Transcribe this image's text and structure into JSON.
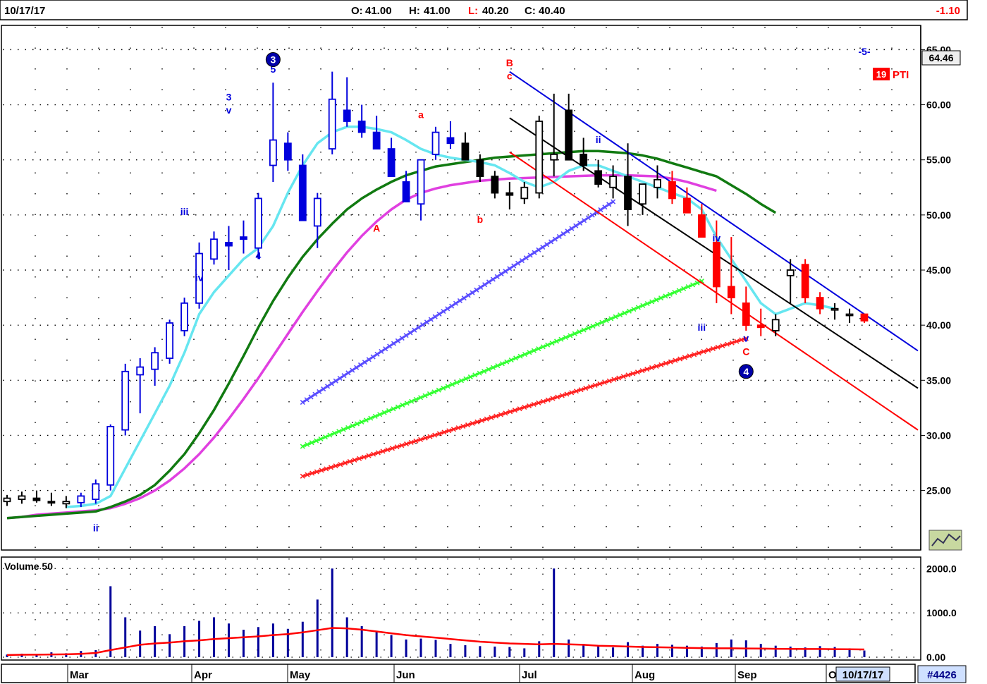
{
  "header": {
    "date": "10/17/17",
    "open_label": "O:",
    "open": "41.00",
    "high_label": "H:",
    "high": "41.00",
    "low_label": "L:",
    "low": "40.20",
    "close_label": "C:",
    "close": "40.40",
    "change": "-1.10"
  },
  "price_panel": {
    "last_price_tag": "64.46",
    "pti_value": "19",
    "pti_label": "PTI",
    "y_ticks": [
      "25.00",
      "30.00",
      "35.00",
      "40.00",
      "45.00",
      "50.00",
      "55.00",
      "60.00",
      "65.00"
    ]
  },
  "volume_panel": {
    "label": "Volume 50",
    "y_ticks": [
      "0.00",
      "1000.0",
      "2000.0"
    ]
  },
  "x_axis": {
    "months": [
      "Mar",
      "Apr",
      "May",
      "Jun",
      "Jul",
      "Aug",
      "Sep",
      "O"
    ],
    "current_date": "10/17/17",
    "chart_number": "#4426"
  },
  "colors": {
    "up_candle": "#0000dd",
    "down_candle": "#000000",
    "red_candle": "#ff0000",
    "ma_short": "#66e6f0",
    "ma_mid": "#117a11",
    "ma_long": "#e040e0",
    "volume_bar": "#00009a",
    "volume_avg": "#ff0000"
  },
  "chart_data": {
    "type": "candlestick",
    "ylim": [
      20,
      67
    ],
    "volume_ylim": [
      0,
      2100
    ],
    "grid": true,
    "dates": [
      "Feb 14",
      "Feb 17",
      "Feb 22",
      "Feb 27",
      "Mar 2",
      "Mar 7",
      "Mar 10",
      "Mar 15",
      "Mar 20",
      "Mar 23",
      "Mar 28",
      "Mar 31",
      "Apr 5",
      "Apr 10",
      "Apr 13",
      "Apr 18",
      "Apr 21",
      "Apr 26",
      "May 1",
      "May 4",
      "May 9",
      "May 12",
      "May 17",
      "May 22",
      "May 25",
      "May 30",
      "Jun 2",
      "Jun 7",
      "Jun 12",
      "Jun 15",
      "Jun 20",
      "Jun 23",
      "Jun 28",
      "Jul 3",
      "Jul 6",
      "Jul 11",
      "Jul 14",
      "Jul 19",
      "Jul 24",
      "Jul 27",
      "Aug 1",
      "Aug 4",
      "Aug 9",
      "Aug 14",
      "Aug 17",
      "Aug 22",
      "Aug 25",
      "Aug 30",
      "Sep 5",
      "Sep 8",
      "Sep 13",
      "Sep 18",
      "Sep 21",
      "Sep 26",
      "Sep 29",
      "Oct 4",
      "Oct 9",
      "Oct 12",
      "Oct 17"
    ],
    "open": [
      24.0,
      24.2,
      24.3,
      24.0,
      23.8,
      23.9,
      24.2,
      25.5,
      30.5,
      35.5,
      36.0,
      37.0,
      39.5,
      42.0,
      46.0,
      47.5,
      48.0,
      47.0,
      54.5,
      56.5,
      54.5,
      49.0,
      56.0,
      59.5,
      58.5,
      57.5,
      56.0,
      53.0,
      51.0,
      55.5,
      57.0,
      56.5,
      55.0,
      53.5,
      52.0,
      51.5,
      52.0,
      55.0,
      59.5,
      55.5,
      54.0,
      52.5,
      53.5,
      51.0,
      52.5,
      53.0,
      51.5,
      50.0,
      47.5,
      43.5,
      42.0,
      40.0,
      39.5,
      44.5,
      45.5,
      42.5,
      41.5,
      41.0,
      41.0
    ],
    "high": [
      24.6,
      24.9,
      25.0,
      24.8,
      24.5,
      24.8,
      26.0,
      31.0,
      36.5,
      37.0,
      38.0,
      40.5,
      42.5,
      47.5,
      48.5,
      49.0,
      49.5,
      52.0,
      62.0,
      57.5,
      55.5,
      52.0,
      63.0,
      62.5,
      60.0,
      59.0,
      57.0,
      54.0,
      52.5,
      58.0,
      58.5,
      57.5,
      55.5,
      54.0,
      53.0,
      53.0,
      59.0,
      61.0,
      61.0,
      57.0,
      55.0,
      54.5,
      56.5,
      52.5,
      54.5,
      54.0,
      52.5,
      51.0,
      49.5,
      48.0,
      43.5,
      41.5,
      41.0,
      46.0,
      46.0,
      43.0,
      42.0,
      41.5,
      41.0
    ],
    "low": [
      23.6,
      23.8,
      23.9,
      23.6,
      23.4,
      23.5,
      23.8,
      25.0,
      30.0,
      32.0,
      34.5,
      36.5,
      39.0,
      41.5,
      45.5,
      45.0,
      46.5,
      46.0,
      53.0,
      54.0,
      51.0,
      47.0,
      55.5,
      58.0,
      57.0,
      56.5,
      54.0,
      51.5,
      49.5,
      55.0,
      56.0,
      55.0,
      53.0,
      51.5,
      50.5,
      51.0,
      51.5,
      53.5,
      55.5,
      54.0,
      52.5,
      51.5,
      49.0,
      50.0,
      51.5,
      51.0,
      50.5,
      49.5,
      42.0,
      41.0,
      39.5,
      39.0,
      39.0,
      42.0,
      42.0,
      41.0,
      40.5,
      40.2,
      40.2
    ],
    "close": [
      24.3,
      24.5,
      24.1,
      23.9,
      24.0,
      24.5,
      25.6,
      30.8,
      35.8,
      36.2,
      37.5,
      40.2,
      42.0,
      46.5,
      47.8,
      47.2,
      47.8,
      51.5,
      56.8,
      55.0,
      49.5,
      51.5,
      60.5,
      58.5,
      57.5,
      56.0,
      53.5,
      51.2,
      55.0,
      57.5,
      56.5,
      55.0,
      53.5,
      52.0,
      51.8,
      52.5,
      58.5,
      55.5,
      55.0,
      54.5,
      52.8,
      53.5,
      50.5,
      52.8,
      53.2,
      51.5,
      50.2,
      48.0,
      43.5,
      42.5,
      40.0,
      39.8,
      40.5,
      45.0,
      42.5,
      41.5,
      41.5,
      41.0,
      40.4
    ],
    "volume": [
      60,
      80,
      50,
      110,
      90,
      140,
      160,
      1600,
      900,
      600,
      700,
      520,
      700,
      820,
      900,
      760,
      620,
      680,
      760,
      640,
      800,
      1300,
      2000,
      900,
      700,
      580,
      500,
      400,
      420,
      390,
      300,
      270,
      250,
      240,
      230,
      200,
      360,
      2000,
      400,
      300,
      260,
      220,
      340,
      260,
      300,
      280,
      260,
      240,
      320,
      400,
      380,
      300,
      260,
      240,
      220,
      250,
      230,
      200,
      150
    ],
    "volume_avg": [
      50,
      55,
      58,
      62,
      66,
      75,
      95,
      160,
      220,
      280,
      310,
      330,
      360,
      380,
      410,
      430,
      450,
      470,
      500,
      520,
      560,
      610,
      660,
      650,
      620,
      580,
      540,
      500,
      470,
      440,
      410,
      380,
      350,
      330,
      310,
      300,
      290,
      300,
      290,
      280,
      260,
      250,
      240,
      230,
      225,
      220,
      210,
      205,
      200,
      200,
      198,
      195,
      190,
      188,
      185,
      185,
      182,
      180,
      175
    ],
    "ma_short": [
      null,
      null,
      null,
      null,
      23.5,
      23.6,
      23.8,
      24.5,
      27,
      29.5,
      32,
      34.5,
      37.5,
      41,
      43,
      44.5,
      46,
      47,
      49,
      52,
      54.5,
      56.5,
      57.5,
      58,
      58,
      57.8,
      57.5,
      56.8,
      56,
      55.5,
      55.2,
      55,
      54.8,
      54.5,
      53.8,
      53,
      52.5,
      53,
      54,
      54.5,
      54.5,
      54,
      53.5,
      53,
      52.5,
      52,
      51.5,
      50.5,
      48,
      46,
      44,
      42,
      41,
      41.5,
      42,
      41.8,
      41.5,
      null,
      null
    ],
    "ma_mid": [
      22.5,
      22.6,
      22.7,
      22.8,
      22.9,
      23,
      23.1,
      23.5,
      24,
      24.6,
      25.5,
      26.8,
      28.3,
      30.2,
      32.3,
      34.7,
      37.2,
      39.8,
      42.2,
      44.3,
      46.2,
      47.8,
      49.2,
      50.5,
      51.5,
      52.3,
      53,
      53.6,
      54,
      54.4,
      54.6,
      54.8,
      55,
      55.2,
      55.3,
      55.4,
      55.5,
      55.6,
      55.7,
      55.8,
      55.8,
      55.7,
      55.6,
      55.4,
      55.1,
      54.7,
      54.3,
      53.9,
      53.5,
      52.7,
      51.9,
      51,
      50.2,
      null,
      null,
      null,
      null,
      null,
      null
    ],
    "ma_long": [
      22.5,
      22.6,
      22.8,
      22.9,
      23,
      23.1,
      23.2,
      23.4,
      23.8,
      24.3,
      25,
      25.9,
      27,
      28.3,
      29.8,
      31.5,
      33.3,
      35.2,
      37.2,
      39.2,
      41.2,
      43.1,
      44.9,
      46.6,
      48.1,
      49.4,
      50.5,
      51.4,
      52,
      52.4,
      52.7,
      52.9,
      53.1,
      53.2,
      53.3,
      53.35,
      53.4,
      53.45,
      53.5,
      53.55,
      53.6,
      53.6,
      53.6,
      53.55,
      53.5,
      53.3,
      53,
      52.6,
      52.2,
      null,
      null,
      null,
      null,
      null,
      null,
      null,
      null,
      null,
      null
    ],
    "wave_labels": [
      {
        "text": "ii",
        "x": "Mar 10",
        "y": 21.3,
        "color": "#0000dd"
      },
      {
        "text": "3",
        "x": "Apr 18",
        "y": 60.4,
        "color": "#0000dd"
      },
      {
        "text": "v",
        "x": "Apr 18",
        "y": 59.2,
        "color": "#0000dd"
      },
      {
        "text": "iii",
        "x": "Apr 5",
        "y": 50.0,
        "color": "#0000dd"
      },
      {
        "text": "iv",
        "x": "Apr 10",
        "y": 44.0,
        "color": "#0000dd"
      },
      {
        "text": "4",
        "x": "Apr 26",
        "y": 46.0,
        "color": "#0000dd"
      },
      {
        "text": "5",
        "x": "May 1",
        "y": 62.9,
        "color": "#0000dd"
      },
      {
        "text": "A",
        "x": "May 30",
        "y": 48.5,
        "color": "#ff0000"
      },
      {
        "text": "a",
        "x": "Jun 12",
        "y": 58.8,
        "color": "#ff0000"
      },
      {
        "text": "b",
        "x": "Jun 28",
        "y": 49.3,
        "color": "#ff0000"
      },
      {
        "text": "B",
        "x": "Jul 6",
        "y": 63.5,
        "color": "#ff0000"
      },
      {
        "text": "c",
        "x": "Jul 6",
        "y": 62.3,
        "color": "#ff0000"
      },
      {
        "text": "ii",
        "x": "Aug 1",
        "y": 56.5,
        "color": "#0000dd"
      },
      {
        "text": "iv",
        "x": "Sep 5",
        "y": 47.6,
        "color": "#0000dd"
      },
      {
        "text": "iii",
        "x": "Aug 30",
        "y": 39.5,
        "color": "#0000dd"
      },
      {
        "text": "v",
        "x": "Sep 13",
        "y": 38.5,
        "color": "#0000dd"
      },
      {
        "text": "C",
        "x": "Sep 13",
        "y": 37.3,
        "color": "#ff0000"
      },
      {
        "text": "-5-",
        "x": "Oct 17",
        "y": 64.5,
        "color": "#0000dd"
      }
    ],
    "wave_circles": [
      {
        "text": "3",
        "x": "May 1",
        "y": 64.1
      },
      {
        "text": "4",
        "x": "Sep 13",
        "y": 35.8
      }
    ],
    "channels": [
      {
        "color": "#0000dd",
        "from": [
          "Jul 6",
          63.0
        ],
        "to": [
          "Oct 17",
          41.0
        ]
      },
      {
        "color": "#000000",
        "from": [
          "Jul 6",
          58.8
        ],
        "to": [
          "Oct 17",
          37.5
        ]
      },
      {
        "color": "#ff0000",
        "from": [
          "Jul 6",
          55.7
        ],
        "to": [
          "Oct 17",
          33.8
        ]
      }
    ],
    "fan_lines": [
      {
        "color": "#5a4dff",
        "from": [
          "May 9",
          33.0
        ],
        "to": [
          "Aug 4",
          51.2
        ]
      },
      {
        "color": "#33ff33",
        "from": [
          "May 9",
          29.0
        ],
        "to": [
          "Aug 30",
          44.0
        ]
      },
      {
        "color": "#ff2222",
        "from": [
          "May 9",
          26.3
        ],
        "to": [
          "Sep 13",
          38.8
        ]
      }
    ]
  }
}
